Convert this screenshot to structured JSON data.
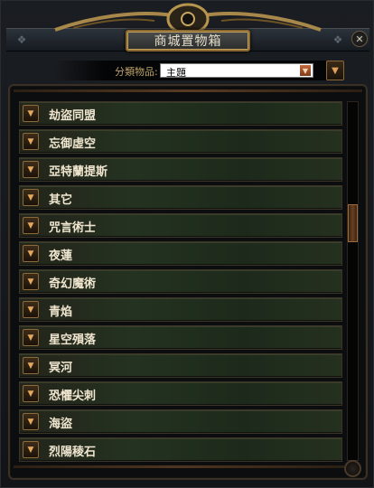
{
  "window": {
    "title": "商城置物箱",
    "close_icon": "close-icon"
  },
  "filter": {
    "label": "分類物品:",
    "selected_value": "主題"
  },
  "categories": [
    {
      "label": "劫盜同盟"
    },
    {
      "label": "忘御虛空"
    },
    {
      "label": "亞特蘭提斯"
    },
    {
      "label": "其它"
    },
    {
      "label": "咒言術士"
    },
    {
      "label": "夜蓮"
    },
    {
      "label": "奇幻魔術"
    },
    {
      "label": "青焰"
    },
    {
      "label": "星空殞落"
    },
    {
      "label": "冥河"
    },
    {
      "label": "恐懼尖刺"
    },
    {
      "label": "海盜"
    },
    {
      "label": "烈陽稜石"
    }
  ],
  "colors": {
    "accent_orange": "#e3a85e",
    "row_green": "#243221",
    "label_gold": "#bfa36b",
    "text_cream": "#f0e6cf"
  },
  "scroll": {
    "position_fraction": 0.32
  }
}
